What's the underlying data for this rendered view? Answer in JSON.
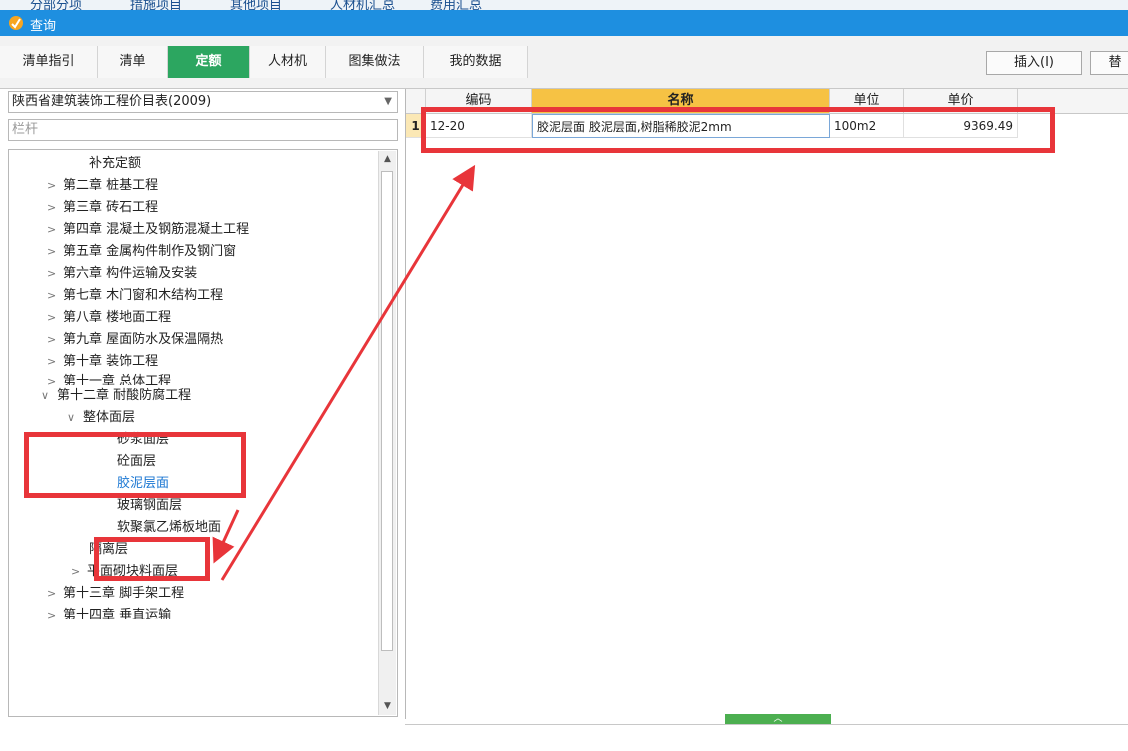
{
  "behind_window": {
    "labels": [
      "分部分项",
      "措施项目",
      "其他项目",
      "人材机汇总",
      "费用汇总"
    ]
  },
  "window": {
    "title": "查询"
  },
  "tabs": [
    {
      "label": "清单指引",
      "active": false
    },
    {
      "label": "清单",
      "active": false
    },
    {
      "label": "定额",
      "active": true
    },
    {
      "label": "人材机",
      "active": false
    },
    {
      "label": "图集做法",
      "active": false
    },
    {
      "label": "我的数据",
      "active": false
    }
  ],
  "buttons": {
    "insert": "插入(I)",
    "replace": "替"
  },
  "left_panel": {
    "catalog": "陕西省建筑装饰工程价目表(2009)",
    "search_value": "栏杆",
    "tree": [
      {
        "label": "补充定额",
        "expander": "none"
      },
      {
        "label": "第二章 桩基工程",
        "expander": "collapsed"
      },
      {
        "label": "第三章 砖石工程",
        "expander": "collapsed"
      },
      {
        "label": "第四章 混凝土及钢筋混凝土工程",
        "expander": "collapsed"
      },
      {
        "label": "第五章 金属构件制作及钢门窗",
        "expander": "collapsed"
      },
      {
        "label": "第六章 构件运输及安装",
        "expander": "collapsed"
      },
      {
        "label": "第七章 木门窗和木结构工程",
        "expander": "collapsed"
      },
      {
        "label": "第八章 楼地面工程",
        "expander": "collapsed"
      },
      {
        "label": "第九章 屋面防水及保温隔热",
        "expander": "collapsed"
      },
      {
        "label": "第十章 装饰工程",
        "expander": "collapsed"
      },
      {
        "label": "第十一章 总体工程",
        "expander": "collapsed"
      },
      {
        "label": "第十二章 耐酸防腐工程",
        "expander": "expanded"
      },
      {
        "label": "整体面层",
        "expander": "expanded"
      },
      {
        "label": "砂浆面层",
        "expander": "none"
      },
      {
        "label": "砼面层",
        "expander": "none"
      },
      {
        "label": "胶泥层面",
        "expander": "none",
        "selected": true
      },
      {
        "label": "玻璃钢面层",
        "expander": "none"
      },
      {
        "label": "软聚氯乙烯板地面",
        "expander": "none"
      },
      {
        "label": "隔离层",
        "expander": "none"
      },
      {
        "label": "平面砌块料面层",
        "expander": "collapsed"
      },
      {
        "label": "第十三章 脚手架工程",
        "expander": "collapsed"
      },
      {
        "label": "第十四章 垂直运输",
        "expander": "collapsed"
      }
    ]
  },
  "grid": {
    "headers": {
      "code": "编码",
      "name": "名称",
      "unit": "单位",
      "price": "单价"
    },
    "rows": [
      {
        "num": "1",
        "code": "12-20",
        "name": "胶泥层面 胶泥层面,树脂稀胶泥2mm",
        "unit": "100m2",
        "price": "9369.49"
      }
    ]
  },
  "colors": {
    "titlebar": "#1e8fe0",
    "active_tab": "#2ca660",
    "name_header": "#f6c244",
    "annotation": "#e8353a",
    "selected_text": "#1976d2"
  }
}
